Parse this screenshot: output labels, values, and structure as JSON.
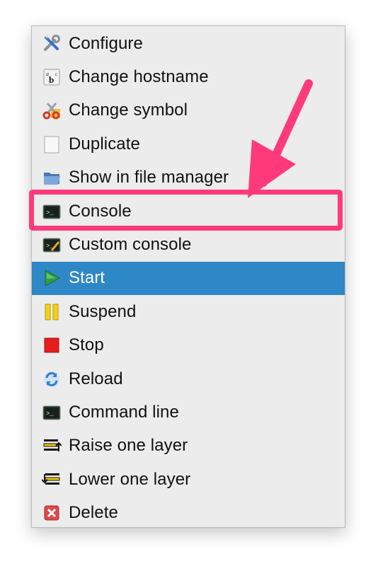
{
  "menu": {
    "items": [
      {
        "label": "Configure",
        "icon": "wrench-screwdriver-icon",
        "highlighted": false
      },
      {
        "label": "Change hostname",
        "icon": "text-abc-icon",
        "highlighted": false
      },
      {
        "label": "Change symbol",
        "icon": "scissors-icon",
        "highlighted": false
      },
      {
        "label": "Duplicate",
        "icon": "blank-page-icon",
        "highlighted": false
      },
      {
        "label": "Show in file manager",
        "icon": "folder-icon",
        "highlighted": false
      },
      {
        "label": "Console",
        "icon": "terminal-icon",
        "highlighted": false
      },
      {
        "label": "Custom console",
        "icon": "terminal-edit-icon",
        "highlighted": false
      },
      {
        "label": "Start",
        "icon": "play-icon",
        "highlighted": true
      },
      {
        "label": "Suspend",
        "icon": "pause-icon",
        "highlighted": false
      },
      {
        "label": "Stop",
        "icon": "stop-icon",
        "highlighted": false
      },
      {
        "label": "Reload",
        "icon": "reload-icon",
        "highlighted": false
      },
      {
        "label": "Command line",
        "icon": "terminal-icon",
        "highlighted": false
      },
      {
        "label": "Raise one layer",
        "icon": "raise-layer-icon",
        "highlighted": false
      },
      {
        "label": "Lower one layer",
        "icon": "lower-layer-icon",
        "highlighted": false
      },
      {
        "label": "Delete",
        "icon": "delete-x-icon",
        "highlighted": false
      }
    ]
  },
  "annotation": {
    "target": "Console",
    "color": "#fe3a7a"
  },
  "colors": {
    "highlight": "#2e87c6",
    "menu_background": "#ececec"
  }
}
